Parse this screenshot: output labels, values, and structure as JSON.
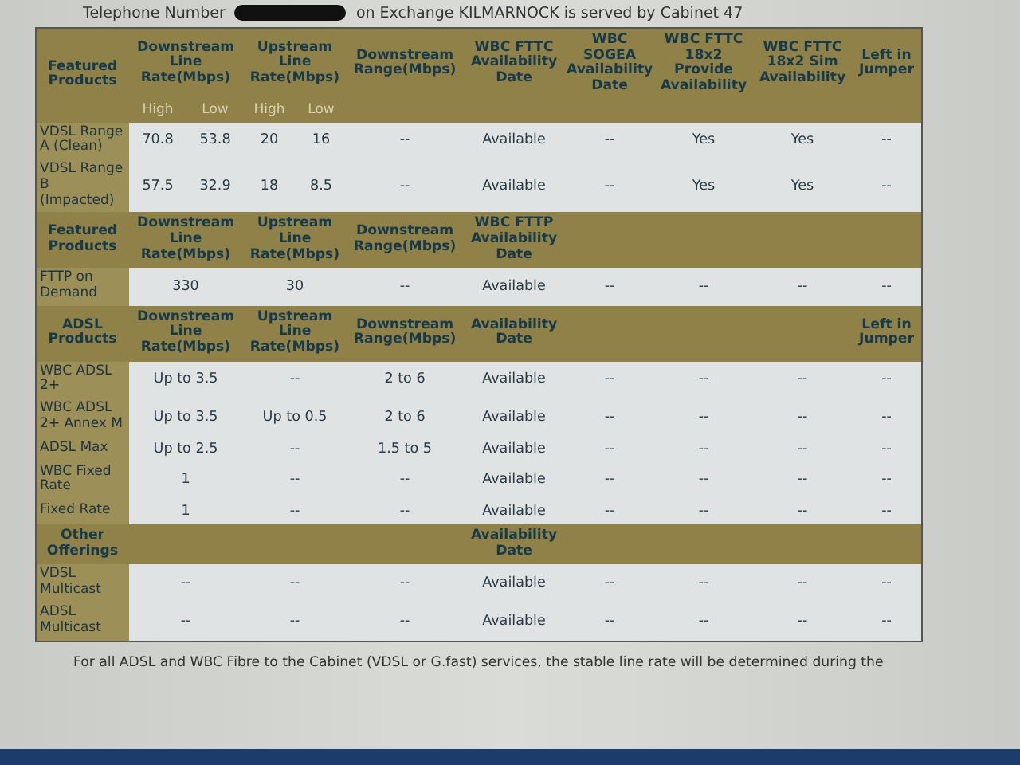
{
  "intro": {
    "before": "Telephone Number",
    "after": "on Exchange KILMARNOCK is served by Cabinet 47"
  },
  "sections": [
    {
      "kind": "split",
      "title": "Featured Products",
      "headers": [
        "Downstream Line Rate(Mbps)",
        "Upstream Line Rate(Mbps)",
        "Downstream Range(Mbps)",
        "WBC FTTC Availability Date",
        "WBC SOGEA Availability Date",
        "WBC FTTC 18x2 Provide Availability",
        "WBC FTTC 18x2 Sim Availability",
        "Left in Jumper"
      ],
      "subheaders": [
        "High",
        "Low",
        "High",
        "Low"
      ],
      "rows": [
        {
          "product": "VDSL Range A (Clean)",
          "cells": [
            "70.8",
            "53.8",
            "20",
            "16",
            "--",
            "Available",
            "--",
            "Yes",
            "Yes",
            "--"
          ]
        },
        {
          "product": "VDSL Range B (Impacted)",
          "cells": [
            "57.5",
            "32.9",
            "18",
            "8.5",
            "--",
            "Available",
            "--",
            "Yes",
            "Yes",
            "--"
          ]
        }
      ]
    },
    {
      "kind": "merged",
      "title": "Featured Products",
      "headers": {
        "downstream_rate": "Downstream Line Rate(Mbps)",
        "upstream_rate": "Upstream Line Rate(Mbps)",
        "downstream_range": "Downstream Range(Mbps)",
        "availability_date": "WBC FTTP Availability Date"
      },
      "rows": [
        {
          "product": "FTTP on Demand",
          "cells": [
            "330",
            "30",
            "--",
            "Available",
            "--",
            "--",
            "--",
            "--"
          ]
        }
      ]
    },
    {
      "kind": "merged",
      "title": "ADSL Products",
      "headers": {
        "downstream_rate": "Downstream Line Rate(Mbps)",
        "upstream_rate": "Upstream Line Rate(Mbps)",
        "downstream_range": "Downstream Range(Mbps)",
        "availability_date": "Availability Date",
        "left_in_jumper": "Left in Jumper"
      },
      "rows": [
        {
          "product": "WBC ADSL 2+",
          "cells": [
            "Up to 3.5",
            "--",
            "2 to 6",
            "Available",
            "--",
            "--",
            "--",
            "--"
          ]
        },
        {
          "product": "WBC ADSL 2+ Annex M",
          "cells": [
            "Up to 3.5",
            "Up to 0.5",
            "2 to 6",
            "Available",
            "--",
            "--",
            "--",
            "--"
          ]
        },
        {
          "product": "ADSL Max",
          "cells": [
            "Up to 2.5",
            "--",
            "1.5 to 5",
            "Available",
            "--",
            "--",
            "--",
            "--"
          ]
        },
        {
          "product": "WBC Fixed Rate",
          "cells": [
            "1",
            "--",
            "--",
            "Available",
            "--",
            "--",
            "--",
            "--"
          ]
        },
        {
          "product": "Fixed Rate",
          "cells": [
            "1",
            "--",
            "--",
            "Available",
            "--",
            "--",
            "--",
            "--"
          ]
        }
      ]
    },
    {
      "kind": "merged",
      "title": "Other Offerings",
      "headers": {
        "availability_date": "Availability Date"
      },
      "rows": [
        {
          "product": "VDSL Multicast",
          "cells": [
            "--",
            "--",
            "--",
            "Available",
            "--",
            "--",
            "--",
            "--"
          ]
        },
        {
          "product": "ADSL Multicast",
          "cells": [
            "--",
            "--",
            "--",
            "Available",
            "--",
            "--",
            "--",
            "--"
          ]
        }
      ]
    }
  ],
  "footnote": "For all ADSL and WBC Fibre to the Cabinet (VDSL or G.fast) services, the stable line rate will be determined during the"
}
